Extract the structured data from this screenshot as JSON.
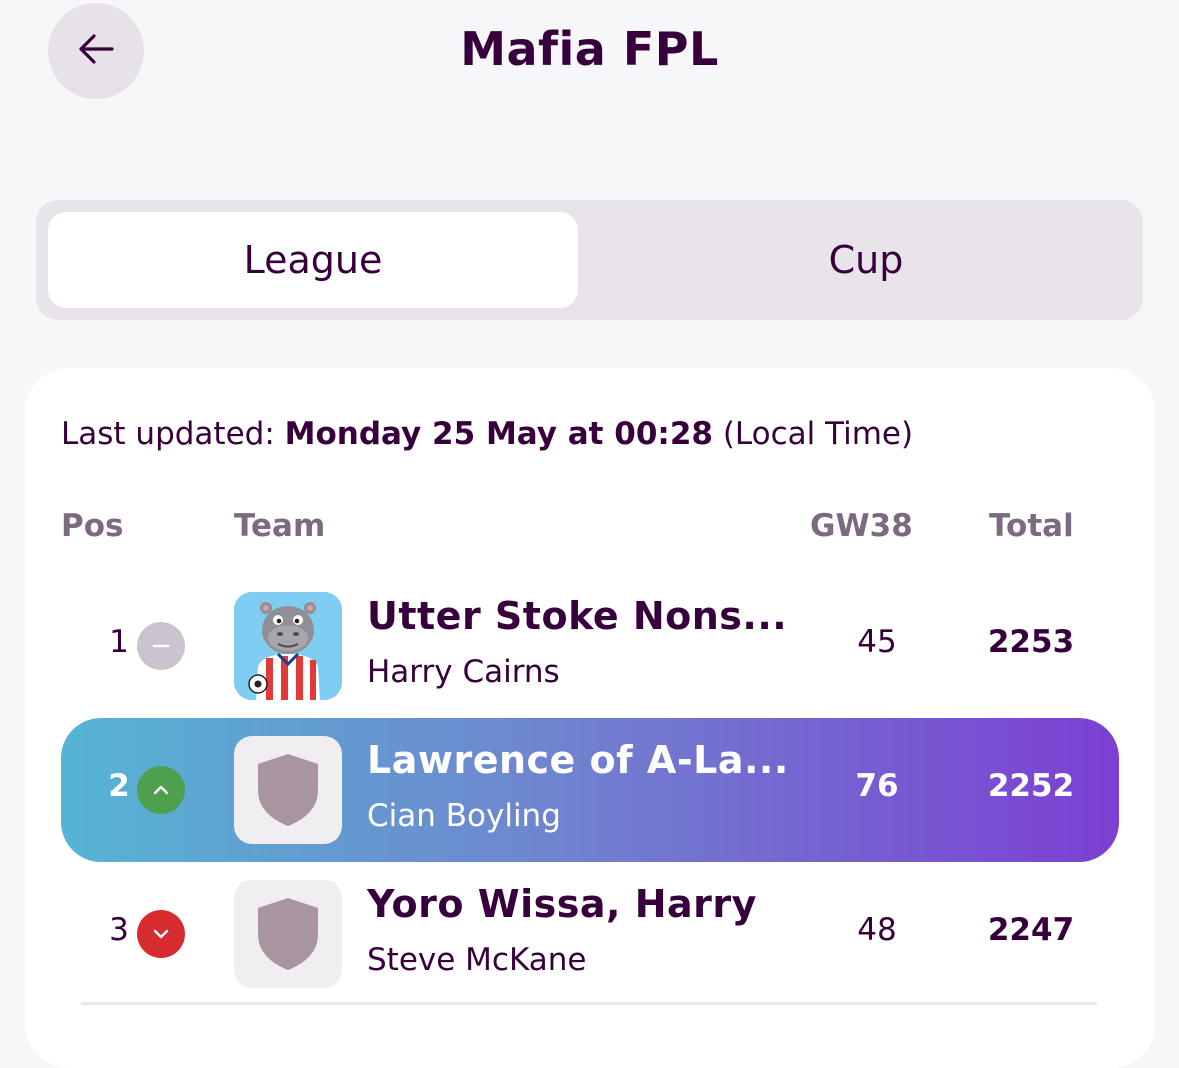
{
  "header": {
    "title": "Mafia FPL",
    "back_icon": "arrow-left-icon"
  },
  "tabs": [
    {
      "label": "League",
      "active": true
    },
    {
      "label": "Cup",
      "active": false
    }
  ],
  "last_updated": {
    "prefix": "Last updated:",
    "value": "Monday 25 May at 00:28",
    "suffix": "(Local Time)"
  },
  "table": {
    "columns": {
      "pos": "Pos",
      "team": "Team",
      "gw": "GW38",
      "total": "Total"
    },
    "rows": [
      {
        "pos": "1",
        "movement": "same",
        "team": "Utter Stoke Nons...",
        "manager": "Harry Cairns",
        "gw": "45",
        "total": "2253",
        "badge": "hippo-mascot-image",
        "highlight": false
      },
      {
        "pos": "2",
        "movement": "up",
        "team": "Lawrence of A-La...",
        "manager": "Cian Boyling",
        "gw": "76",
        "total": "2252",
        "badge": "shield-icon",
        "highlight": true
      },
      {
        "pos": "3",
        "movement": "down",
        "team": "Yoro Wissa, Harry",
        "manager": "Steve McKane",
        "gw": "48",
        "total": "2247",
        "badge": "shield-icon",
        "highlight": false
      }
    ]
  },
  "colors": {
    "primary": "#37003c",
    "up": "#4ea04f",
    "down": "#d62b2f",
    "same": "#cbc3cd",
    "highlight_start": "#55b5d3",
    "highlight_end": "#7c3fd3"
  }
}
